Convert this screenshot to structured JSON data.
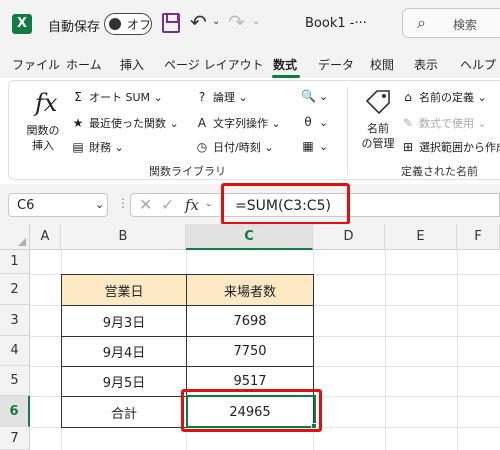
{
  "app": {
    "autosave_label": "自動保存",
    "toggle_state": "オフ",
    "book_title": "Book1  -···",
    "search_placeholder": "検索",
    "logo_letter": "X"
  },
  "tabs": [
    "ファイル",
    "ホーム",
    "挿入",
    "ページ レイアウト",
    "数式",
    "データ",
    "校閲",
    "表示",
    "ヘルプ"
  ],
  "active_tab": "数式",
  "ribbon": {
    "insert_function": {
      "line1": "関数の",
      "line2": "挿入"
    },
    "autosum": "オート SUM",
    "recent": "最近使った関数",
    "finance": "財務",
    "logical": "論理",
    "text": "文字列操作",
    "datetime": "日付/時刻",
    "group_library": "関数ライブラリ",
    "name_manager": {
      "line1": "名前",
      "line2": "の管理"
    },
    "define_name": "名前の定義",
    "use_in_formula": "数式で使用",
    "create_from_selection": "選択範囲から作成",
    "group_names": "定義された名前"
  },
  "formula_bar": {
    "name_box": "C6",
    "formula": "=SUM(C3:C5)"
  },
  "columns": [
    "A",
    "B",
    "C",
    "D",
    "E",
    "F"
  ],
  "rows": [
    "1",
    "2",
    "3",
    "4",
    "5",
    "6",
    "7"
  ],
  "table": {
    "header": [
      "営業日",
      "来場者数"
    ],
    "rows": [
      [
        "9月3日",
        "7698"
      ],
      [
        "9月4日",
        "7750"
      ],
      [
        "9月5日",
        "9517"
      ],
      [
        "合計",
        "24965"
      ]
    ]
  },
  "colors": {
    "accent": "#107c41",
    "highlight": "#e01010",
    "header_fill": "#fde9c4"
  }
}
